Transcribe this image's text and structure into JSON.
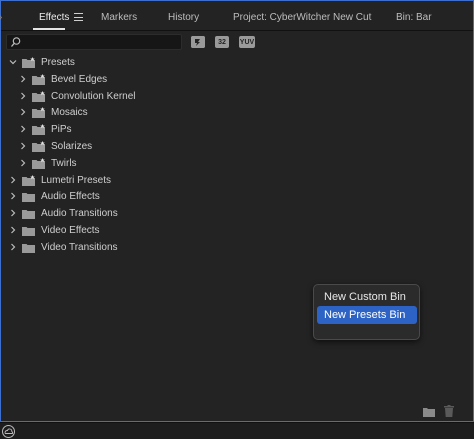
{
  "tabs": [
    {
      "label": "Effects",
      "active": true
    },
    {
      "label": "Markers",
      "active": false
    },
    {
      "label": "History",
      "active": false
    },
    {
      "label": "Project: CyberWitcher New Cut",
      "active": false
    },
    {
      "label": "Bin: Bar",
      "active": false
    }
  ],
  "search": {
    "value": ""
  },
  "filter_buttons": [
    "",
    "32",
    "YUV"
  ],
  "tree": [
    {
      "label": "Presets",
      "expanded": true,
      "level": 0,
      "icon": "preset-folder-icon"
    },
    {
      "label": "Bevel Edges",
      "expanded": false,
      "level": 1,
      "icon": "preset-folder-icon"
    },
    {
      "label": "Convolution Kernel",
      "expanded": false,
      "level": 1,
      "icon": "preset-folder-icon"
    },
    {
      "label": "Mosaics",
      "expanded": false,
      "level": 1,
      "icon": "preset-folder-icon"
    },
    {
      "label": "PiPs",
      "expanded": false,
      "level": 1,
      "icon": "preset-folder-icon"
    },
    {
      "label": "Solarizes",
      "expanded": false,
      "level": 1,
      "icon": "preset-folder-icon"
    },
    {
      "label": "Twirls",
      "expanded": false,
      "level": 1,
      "icon": "preset-folder-icon"
    },
    {
      "label": "Lumetri Presets",
      "expanded": false,
      "level": 0,
      "icon": "preset-folder-icon"
    },
    {
      "label": "Audio Effects",
      "expanded": false,
      "level": 0,
      "icon": "folder-icon"
    },
    {
      "label": "Audio Transitions",
      "expanded": false,
      "level": 0,
      "icon": "folder-icon"
    },
    {
      "label": "Video Effects",
      "expanded": false,
      "level": 0,
      "icon": "folder-icon"
    },
    {
      "label": "Video Transitions",
      "expanded": false,
      "level": 0,
      "icon": "folder-icon"
    }
  ],
  "context_menu": {
    "items": [
      {
        "label": "New Custom Bin",
        "highlighted": false
      },
      {
        "label": "New Presets Bin",
        "highlighted": true
      }
    ]
  },
  "colors": {
    "accent": "#2d63c4",
    "panel_border": "#3d6fd1"
  }
}
